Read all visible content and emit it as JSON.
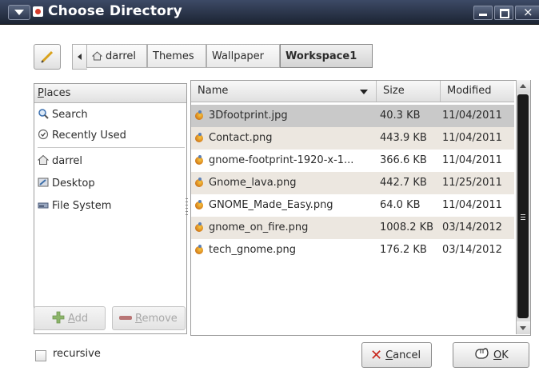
{
  "window": {
    "title": "Choose Directory"
  },
  "pathbar": {
    "crumbs": [
      "darrel",
      "Themes",
      "Wallpaper",
      "Workspace1"
    ]
  },
  "places": {
    "header_mnemonic": "P",
    "header_rest": "laces",
    "items": [
      {
        "label": "Search",
        "icon": "search-icon"
      },
      {
        "label": "Recently Used",
        "icon": "recent-icon"
      },
      {
        "label": "darrel",
        "icon": "home-icon"
      },
      {
        "label": "Desktop",
        "icon": "desktop-icon"
      },
      {
        "label": "File System",
        "icon": "drive-icon"
      }
    ],
    "add_mnemonic": "A",
    "add_rest": "dd",
    "remove_mnemonic": "R",
    "remove_rest": "emove"
  },
  "files": {
    "columns": {
      "name": "Name",
      "size": "Size",
      "modified": "Modified"
    },
    "rows": [
      {
        "name": "3Dfootprint.jpg",
        "size": "40.3 KB",
        "modified": "11/04/2011"
      },
      {
        "name": "Contact.png",
        "size": "443.9 KB",
        "modified": "11/04/2011"
      },
      {
        "name": "gnome-footprint-1920-x-1...",
        "size": "366.6 KB",
        "modified": "11/04/2011"
      },
      {
        "name": "Gnome_lava.png",
        "size": "442.7 KB",
        "modified": "11/25/2011"
      },
      {
        "name": "GNOME_Made_Easy.png",
        "size": "64.0 KB",
        "modified": "11/04/2011"
      },
      {
        "name": "gnome_on_fire.png",
        "size": "1008.2 KB",
        "modified": "03/14/2012"
      },
      {
        "name": "tech_gnome.png",
        "size": "176.2 KB",
        "modified": "03/14/2012"
      }
    ]
  },
  "bottom": {
    "recursive_label": "recursive",
    "cancel_mnemonic": "C",
    "cancel_rest": "ancel",
    "ok_mnemonic": "O",
    "ok_rest": "K"
  },
  "colors": {
    "titlebar": "#1c2433",
    "selected_row": "#c9c9c9",
    "alt_row": "#ece7e0",
    "cancel_x": "#c8281e"
  }
}
